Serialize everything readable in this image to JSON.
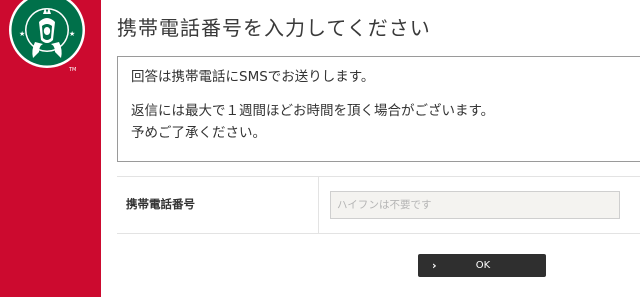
{
  "brand": {
    "logo_icon": "starbucks-siren-logo",
    "sidebar_color": "#cc0a2f",
    "logo_green": "#00704a",
    "trademark": "TM"
  },
  "page": {
    "title": "携帯電話番号を入力してください"
  },
  "notice": {
    "line1": "回答は携帯電話にSMSでお送りします。",
    "line2": "返信には最大で１週間ほどお時間を頂く場合がございます。",
    "line3": "予めご了承ください。"
  },
  "form": {
    "phone_label": "携帯電話番号",
    "phone_placeholder": "ハイフンは不要です",
    "phone_value": ""
  },
  "actions": {
    "ok_label": "OK",
    "ok_icon": "chevron-right-icon",
    "button_color": "#2f2f2f"
  }
}
